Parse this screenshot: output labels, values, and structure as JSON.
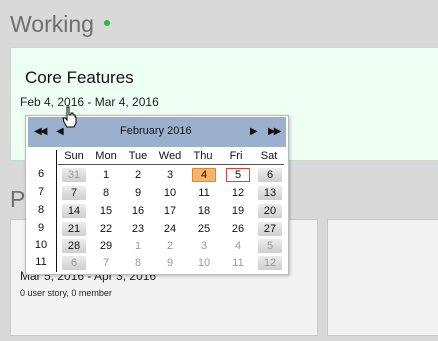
{
  "board": {
    "section_title": "Working",
    "status_color": "#1fbf3a",
    "second_section_initial": "P"
  },
  "card_working": {
    "title": "Core Features",
    "date_range": "Feb 4, 2016 - Mar 4, 2016"
  },
  "card_lower": {
    "date_range": "Mar 5, 2016 - Apr 3, 2016",
    "meta": "0 user story, 0 member"
  },
  "datepicker": {
    "month_label": "February",
    "year_label": "2016",
    "nav": {
      "prev_year": "◀◀",
      "prev_month": "◀",
      "next_month": "▶",
      "next_year": "▶▶"
    },
    "weekdays": [
      "Sun",
      "Mon",
      "Tue",
      "Wed",
      "Thu",
      "Fri",
      "Sat"
    ],
    "weeks": [
      {
        "week": "6",
        "days": [
          "31",
          "1",
          "2",
          "3",
          "4",
          "5",
          "6"
        ],
        "muted": [
          true,
          false,
          false,
          false,
          false,
          false,
          false
        ]
      },
      {
        "week": "7",
        "days": [
          "7",
          "8",
          "9",
          "10",
          "11",
          "12",
          "13"
        ],
        "muted": [
          false,
          false,
          false,
          false,
          false,
          false,
          false
        ]
      },
      {
        "week": "8",
        "days": [
          "14",
          "15",
          "16",
          "17",
          "18",
          "19",
          "20"
        ],
        "muted": [
          false,
          false,
          false,
          false,
          false,
          false,
          false
        ]
      },
      {
        "week": "9",
        "days": [
          "21",
          "22",
          "23",
          "24",
          "25",
          "26",
          "27"
        ],
        "muted": [
          false,
          false,
          false,
          false,
          false,
          false,
          false
        ]
      },
      {
        "week": "10",
        "days": [
          "28",
          "29",
          "1",
          "2",
          "3",
          "4",
          "5"
        ],
        "muted": [
          false,
          false,
          true,
          true,
          true,
          true,
          true
        ]
      },
      {
        "week": "11",
        "days": [
          "6",
          "7",
          "8",
          "9",
          "10",
          "11",
          "12"
        ],
        "muted": [
          true,
          true,
          true,
          true,
          true,
          true,
          true
        ]
      }
    ],
    "selected_day": "4",
    "today_day": "5",
    "selected_color": "#f7b36b",
    "today_border_color": "#d2453d",
    "header_color": "#9bb0cd"
  }
}
